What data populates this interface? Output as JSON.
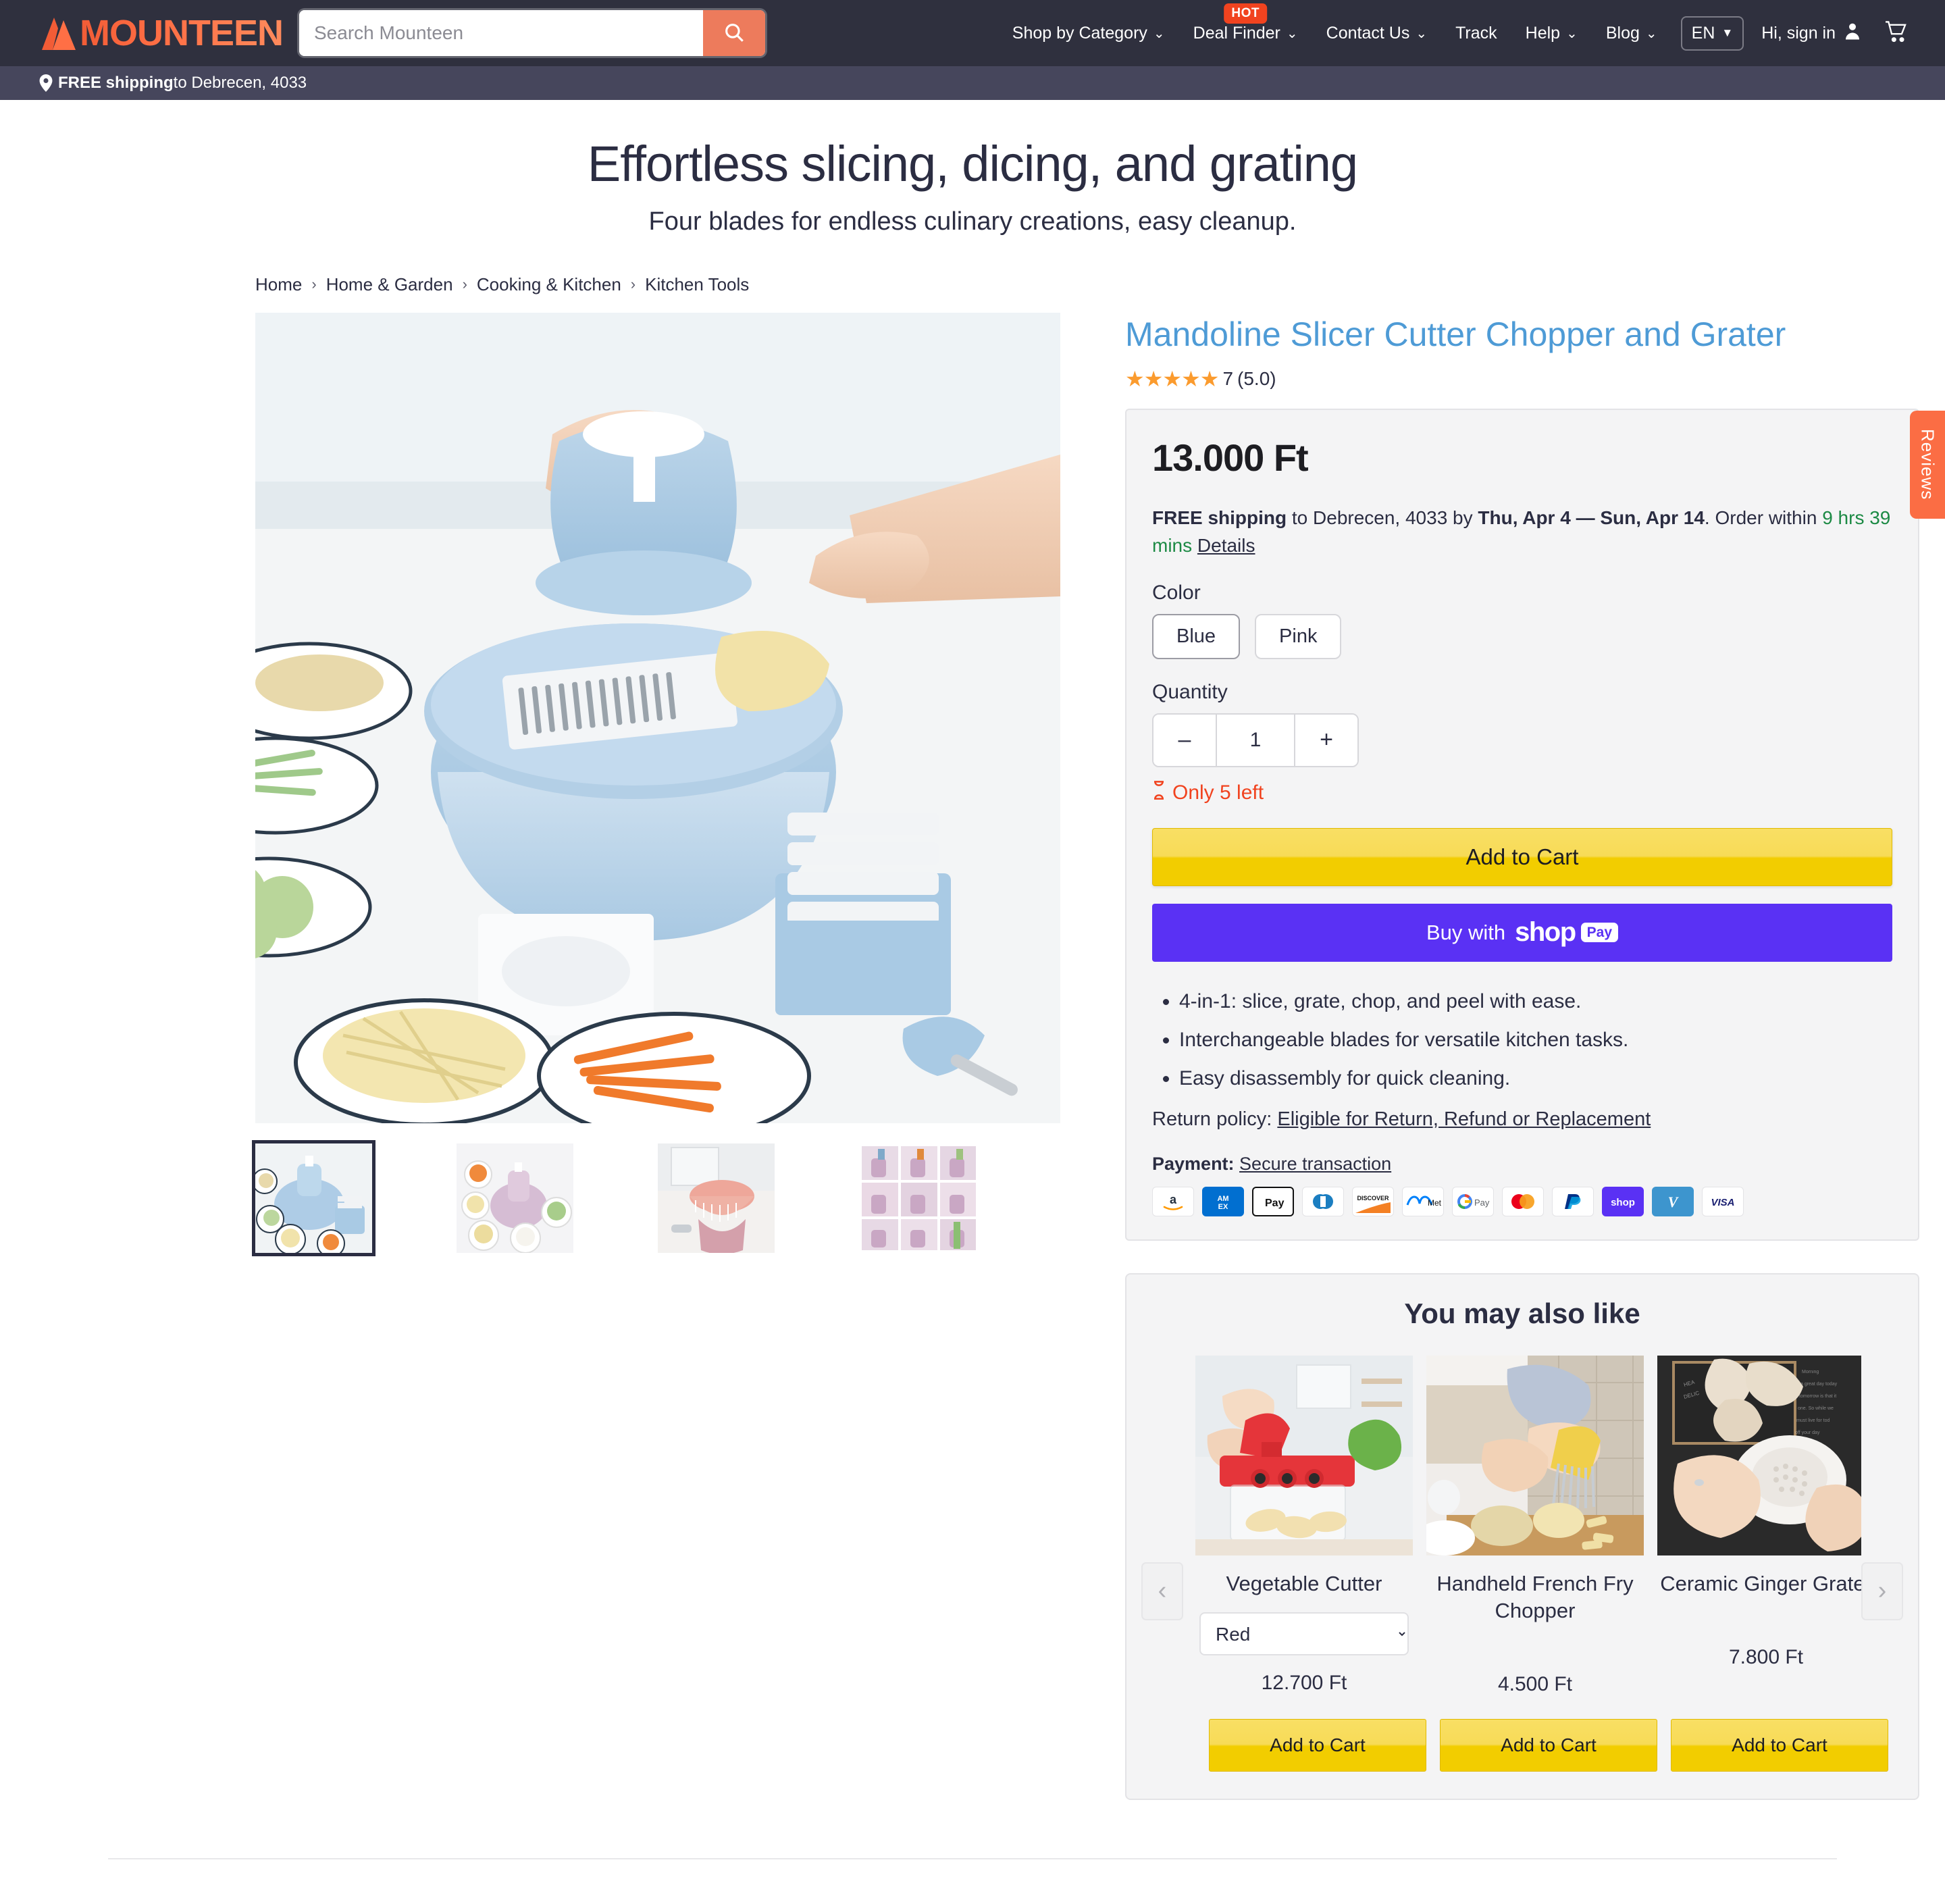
{
  "header": {
    "brand": "MOUNTEEN",
    "search": {
      "placeholder": "Search Mounteen",
      "value": "",
      "icon": "search-icon"
    },
    "nav": [
      {
        "label": "Shop by Category",
        "caret": "⌄",
        "badge": ""
      },
      {
        "label": "Deal Finder",
        "caret": "⌄",
        "badge": "HOT"
      },
      {
        "label": "Contact Us",
        "caret": "⌄",
        "badge": ""
      },
      {
        "label": "Track",
        "caret": "",
        "badge": ""
      },
      {
        "label": "Help",
        "caret": "⌄",
        "badge": ""
      },
      {
        "label": "Blog",
        "caret": "⌄",
        "badge": ""
      }
    ],
    "language": {
      "label": "EN",
      "caret": "▼"
    },
    "account": {
      "label": "Hi, sign in",
      "icon": "user-icon"
    },
    "cart": {
      "icon": "cart-icon"
    },
    "shipping_bar": {
      "icon": "location-pin-icon",
      "strong": "FREE shipping",
      "rest": " to Debrecen, 4033"
    }
  },
  "hero": {
    "title": "Effortless slicing, dicing, and grating",
    "subtitle": "Four blades for endless culinary creations, easy cleanup."
  },
  "breadcrumb": [
    {
      "label": "Home"
    },
    {
      "label": "Home & Garden"
    },
    {
      "label": "Cooking & Kitchen"
    },
    {
      "label": "Kitchen Tools"
    }
  ],
  "breadcrumb_separator": "›",
  "gallery": {
    "main_alt": "Blue mandoline slicer with vegetables",
    "thumbs": [
      {
        "alt": "Blue mandoline slicer set",
        "selected": true
      },
      {
        "alt": "Pink slicer with vegetables",
        "selected": false
      },
      {
        "alt": "Draining basket over sink",
        "selected": false
      },
      {
        "alt": "Collage of slicer uses",
        "selected": false
      }
    ]
  },
  "product": {
    "title": "Mandoline Slicer Cutter Chopper and Grater",
    "stars": "★★★★★",
    "review_count": "7",
    "rating_value": "(5.0)",
    "price": "13.000 Ft",
    "shipping": {
      "free_label": "FREE shipping",
      "to_text": " to Debrecen, 4033 by ",
      "dates": "Thu, Apr 4 — Sun, Apr 14",
      "order_within": ". Order within ",
      "countdown": "9 hrs 39 mins",
      "details_link": "Details"
    },
    "color_label": "Color",
    "colors": [
      {
        "label": "Blue",
        "selected": true
      },
      {
        "label": "Pink",
        "selected": false
      }
    ],
    "quantity_label": "Quantity",
    "quantity": {
      "decrement": "–",
      "value": "1",
      "increment": "+"
    },
    "stock_warning": {
      "icon": "hourglass-icon",
      "text": "Only 5 left"
    },
    "add_to_cart_label": "Add to Cart",
    "shop_pay": {
      "prefix": "Buy with",
      "brand": "shop",
      "chip": "Pay"
    },
    "features": [
      "4-in-1: slice, grate, chop, and peel with ease.",
      "Interchangeable blades for versatile kitchen tasks.",
      "Easy disassembly for quick cleaning."
    ],
    "return_policy": {
      "label": "Return policy: ",
      "link": "Eligible for Return, Refund or Replacement"
    },
    "payment": {
      "label": "Payment: ",
      "link": "Secure transaction",
      "methods": [
        "amazon-pay-icon",
        "amex-icon",
        "apple-pay-icon",
        "diners-club-icon",
        "discover-icon",
        "meta-pay-icon",
        "google-pay-icon",
        "mastercard-icon",
        "paypal-icon",
        "shop-pay-icon",
        "venmo-icon",
        "visa-icon"
      ]
    }
  },
  "recommendations": {
    "heading": "You may also like",
    "prev_arrow": "‹",
    "next_arrow": "›",
    "add_to_cart_label": "Add to Cart",
    "items": [
      {
        "title": "Vegetable Cutter",
        "variant": "Red",
        "price": "12.700 Ft",
        "alt": "Red vegetable cutter with lettuce",
        "has_select": true
      },
      {
        "title": "Handheld French Fry Chopper",
        "variant": "",
        "price": "4.500 Ft",
        "alt": "Hands cutting potato with chopper",
        "has_select": false
      },
      {
        "title": "Ceramic Ginger Grater",
        "variant": "",
        "price": "7.800 Ft",
        "alt": "Ceramic ginger grater with ginger root",
        "has_select": false
      }
    ]
  },
  "reviews_tab": {
    "label": "Reviews"
  },
  "colors": {
    "header_bg": "#2f303e",
    "shipbar_bg": "#46465c",
    "accent_orange": "#ed7b5c",
    "brand_orange": "#f25c36",
    "title_blue": "#4e9bd6",
    "star_gold": "#fb9b2e",
    "cart_yellow": "#f2cd00",
    "shop_purple": "#5a31f4",
    "alert_red": "#f1431f",
    "green": "#1d8a45",
    "text_dark": "#2b2d42",
    "reviews_tab": "#fb6d44"
  }
}
